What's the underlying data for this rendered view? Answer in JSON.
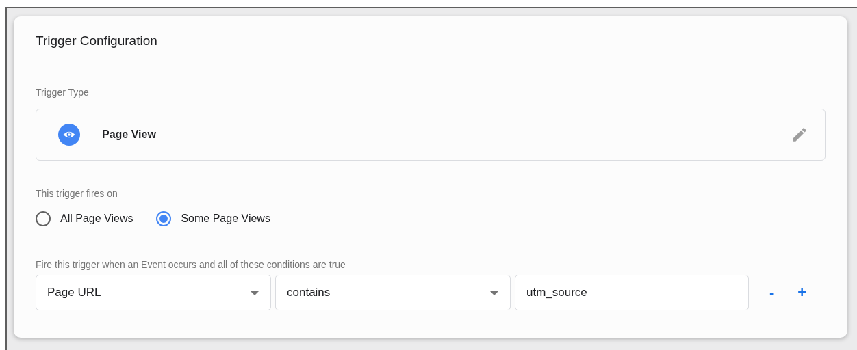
{
  "card": {
    "title": "Trigger Configuration"
  },
  "trigger_type": {
    "label": "Trigger Type",
    "name": "Page View"
  },
  "fires_on": {
    "label": "This trigger fires on",
    "options": [
      {
        "label": "All Page Views",
        "selected": false
      },
      {
        "label": "Some Page Views",
        "selected": true
      }
    ]
  },
  "conditions": {
    "label": "Fire this trigger when an Event occurs and all of these conditions are true",
    "rows": [
      {
        "variable": "Page URL",
        "operator": "contains",
        "value": "utm_source",
        "remove": "-",
        "add": "+"
      }
    ]
  }
}
